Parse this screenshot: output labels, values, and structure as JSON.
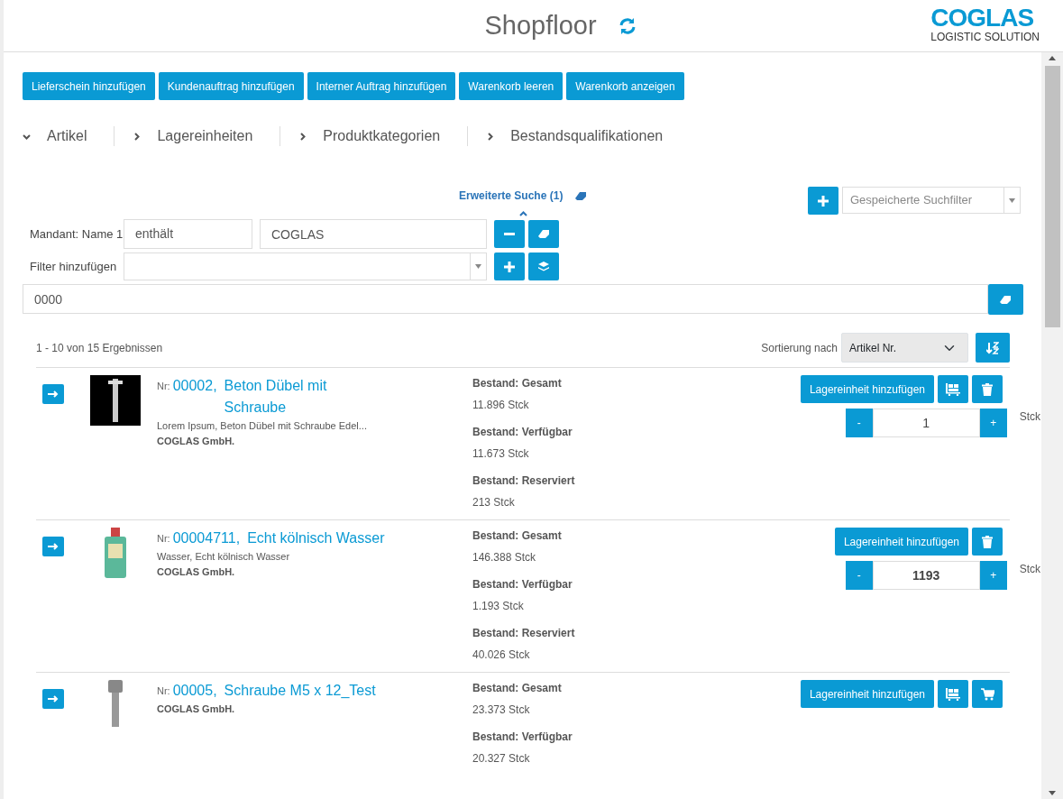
{
  "header": {
    "title": "Shopfloor",
    "logo_top": "COGLAS",
    "logo_bottom": "LOGISTIC SOLUTION"
  },
  "actions": [
    "Lieferschein hinzufügen",
    "Kundenauftrag hinzufügen",
    "Interner Auftrag hinzufügen",
    "Warenkorb leeren",
    "Warenkorb anzeigen"
  ],
  "tabs": [
    {
      "label": "Artikel",
      "expanded": true
    },
    {
      "label": "Lagereinheiten",
      "expanded": false
    },
    {
      "label": "Produktkategorien",
      "expanded": false
    },
    {
      "label": "Bestandsqualifikationen",
      "expanded": false
    }
  ],
  "search": {
    "advanced_label": "Erweiterte Suche (1)",
    "saved_filter_placeholder": "Gespeicherte Suchfilter",
    "filters": [
      {
        "label": "Mandant: Name 1",
        "operator": "enthält",
        "value": "COGLAS"
      }
    ],
    "add_filter_label": "Filter hinzufügen",
    "query": "0000"
  },
  "results": {
    "summary": "1 - 10 von 15 Ergebnissen",
    "sort_label": "Sortierung nach",
    "sort_value": "Artikel Nr."
  },
  "items": [
    {
      "nr_label": "Nr:",
      "nr": "00002,",
      "name": "Beton Dübel mit Schraube",
      "description": "Lorem Ipsum, Beton Dübel mit Schraube Edel...",
      "company": "COGLAS GmbH.",
      "stock": [
        {
          "label": "Bestand: Gesamt",
          "value": "11.896 Stck"
        },
        {
          "label": "Bestand: Verfügbar",
          "value": "11.673 Stck"
        },
        {
          "label": "Bestand: Reserviert",
          "value": "213 Stck"
        }
      ],
      "buttons": [
        {
          "kind": "text",
          "label": "Lagereinheit hinzufügen"
        },
        {
          "kind": "pallet"
        },
        {
          "kind": "trash"
        }
      ],
      "quantity": {
        "minus": "-",
        "value": "1",
        "plus": "+",
        "unit": "Stck",
        "bold": false
      }
    },
    {
      "nr_label": "Nr:",
      "nr": "00004711,",
      "name": "Echt kölnisch Wasser",
      "description": "Wasser, Echt kölnisch Wasser",
      "company": "COGLAS GmbH.",
      "stock": [
        {
          "label": "Bestand: Gesamt",
          "value": "146.388 Stck"
        },
        {
          "label": "Bestand: Verfügbar",
          "value": "1.193 Stck"
        },
        {
          "label": "Bestand: Reserviert",
          "value": "40.026 Stck"
        }
      ],
      "buttons": [
        {
          "kind": "text",
          "label": "Lagereinheit hinzufügen"
        },
        {
          "kind": "trash"
        }
      ],
      "quantity": {
        "minus": "-",
        "value": "1193",
        "plus": "+",
        "unit": "Stck",
        "bold": true
      }
    },
    {
      "nr_label": "Nr:",
      "nr": "00005,",
      "name": "Schraube M5 x 12_Test",
      "company": "COGLAS GmbH.",
      "stock": [
        {
          "label": "Bestand: Gesamt",
          "value": "23.373 Stck"
        },
        {
          "label": "Bestand: Verfügbar",
          "value": "20.327 Stck"
        }
      ],
      "buttons": [
        {
          "kind": "text",
          "label": "Lagereinheit hinzufügen"
        },
        {
          "kind": "pallet"
        },
        {
          "kind": "cart"
        }
      ]
    }
  ]
}
